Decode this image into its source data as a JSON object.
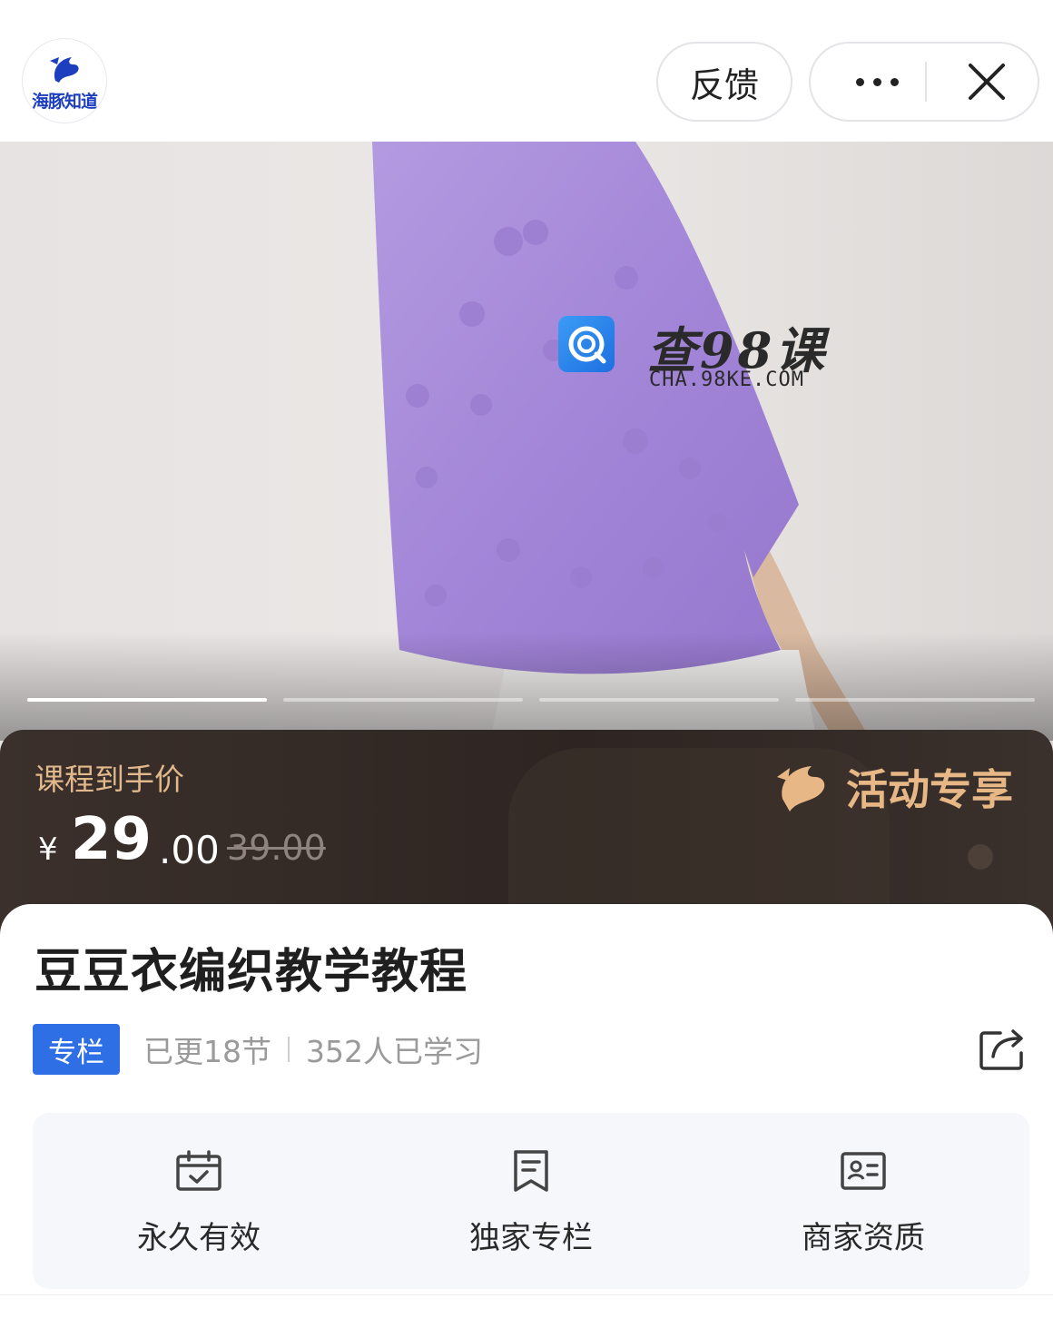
{
  "header": {
    "logo_text": "海豚知道",
    "feedback_label": "反馈",
    "more_icon": "more-dots-icon",
    "close_icon": "close-icon"
  },
  "hero": {
    "watermark_title": "查98课",
    "watermark_url": "CHA.98KE.COM",
    "slides_total": 4,
    "slide_active": 1
  },
  "price": {
    "caption": "课程到手价",
    "currency": "¥",
    "integer": "29",
    "decimal": ".00",
    "original": "39.00",
    "promo_label": "活动专享"
  },
  "course": {
    "title": "豆豆衣编织教学教程",
    "tag": "专栏",
    "updated": "已更18节",
    "learners": "352人已学习"
  },
  "features": [
    {
      "icon": "calendar-check-icon",
      "label": "永久有效"
    },
    {
      "icon": "bookmark-doc-icon",
      "label": "独家专栏"
    },
    {
      "icon": "id-card-icon",
      "label": "商家资质"
    }
  ],
  "colors": {
    "accent_blue": "#2f6fe6",
    "price_gold": "#e2b98d",
    "price_band": "#2e2522",
    "sweater_purple": "#a387d6"
  }
}
